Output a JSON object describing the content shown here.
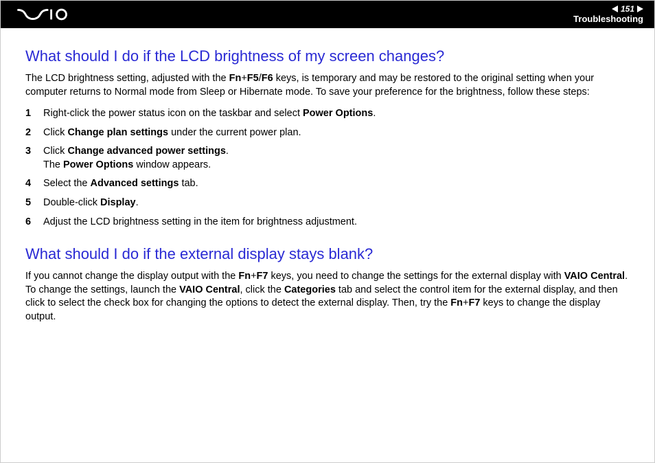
{
  "header": {
    "page_number": "151",
    "section": "Troubleshooting",
    "logo_alt": "VAIO"
  },
  "q1": {
    "title": "What should I do if the LCD brightness of my screen changes?",
    "intro_a": "The LCD brightness setting, adjusted with the ",
    "intro_keys": "Fn",
    "intro_plus1": "+",
    "intro_keys2": "F5",
    "intro_slash": "/",
    "intro_keys3": "F6",
    "intro_b": " keys, is temporary and may be restored to the original setting when your computer returns to Normal mode from Sleep or Hibernate mode. To save your preference for the brightness, follow these steps:",
    "steps": [
      {
        "n": "1",
        "a": "Right-click the power status icon on the taskbar and select ",
        "b1": "Power Options",
        "c": "."
      },
      {
        "n": "2",
        "a": "Click ",
        "b1": "Change plan settings",
        "c": " under the current power plan."
      },
      {
        "n": "3",
        "a": "Click ",
        "b1": "Change advanced power settings",
        "c": ".",
        "br": true,
        "d": "The ",
        "b2": "Power Options",
        "e": " window appears."
      },
      {
        "n": "4",
        "a": "Select the ",
        "b1": "Advanced settings",
        "c": " tab."
      },
      {
        "n": "5",
        "a": "Double-click ",
        "b1": "Display",
        "c": "."
      },
      {
        "n": "6",
        "a": "Adjust the LCD brightness setting in the item for brightness adjustment."
      }
    ]
  },
  "q2": {
    "title": "What should I do if the external display stays blank?",
    "p_a": "If you cannot change the display output with the ",
    "p_k1": "Fn",
    "p_plus1": "+",
    "p_k2": "F7",
    "p_b": " keys, you need to change the settings for the external display with ",
    "p_vc": "VAIO Central",
    "p_c": ". To change the settings, launch the ",
    "p_vc2": "VAIO Central",
    "p_d": ", click the ",
    "p_cat": "Categories",
    "p_e": " tab and select the control item for the external display, and then click to select the check box for changing the options to detect the external display. Then, try the ",
    "p_k3": "Fn",
    "p_plus2": "+",
    "p_k4": "F7",
    "p_f": " keys to change the display output."
  }
}
